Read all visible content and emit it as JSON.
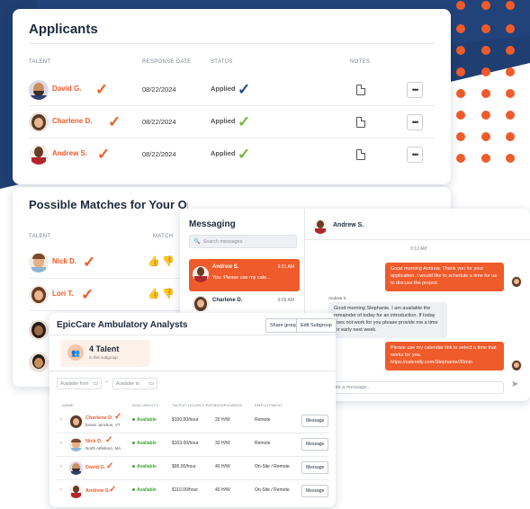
{
  "colors": {
    "accent": "#ef5b2b",
    "navy": "#1f3f72",
    "applied_blue": "#1f4e8c",
    "applied_green": "#6cbb3c",
    "available": "#3fa535"
  },
  "applicants": {
    "title": "Applicants",
    "headers": {
      "talent": "TALENT",
      "response_date": "RESPONSE DATE",
      "status": "STATUS",
      "notes": "NOTES"
    },
    "rows": [
      {
        "name": "David G.",
        "date": "08/22/2024",
        "status": "Applied",
        "status_color": "blue"
      },
      {
        "name": "Charlene D.",
        "date": "08/22/2024",
        "status": "Applied",
        "status_color": "green"
      },
      {
        "name": "Andrew S.",
        "date": "08/22/2024",
        "status": "Applied",
        "status_color": "green"
      }
    ],
    "more_label": "•••"
  },
  "matches": {
    "title": "Possible Matches for Your Opportunity",
    "headers": {
      "talent": "TALENT",
      "match": "MATCH"
    },
    "rows": [
      {
        "name": "Nick D."
      },
      {
        "name": "Lori T."
      }
    ]
  },
  "messaging": {
    "title": "Messaging",
    "search_placeholder": "Search messages",
    "active_contact": "Andrew S.",
    "conversations": [
      {
        "name": "Andrew S.",
        "time": "9:21 AM",
        "preview": "You: Please use my cale..."
      },
      {
        "name": "Charlene D.",
        "time": "9:09 AM",
        "preview": ""
      }
    ],
    "timestamp": "9:12 AM",
    "messages": [
      {
        "from": "me",
        "text": "Good morning Andrew. Thank you for your application. I would like to schedule a time for us to discuss the project."
      },
      {
        "from": "them",
        "sender": "Andrew S.",
        "text": "Good morning Stephanie. I am available the remainder of today for an introduction. If today does not work for you please provide me a time for early next week."
      },
      {
        "from": "me",
        "text": "Please use my calendar link to select a time that works for you. https://calendly.com/Stephanie/30min"
      }
    ],
    "input_placeholder": "Write a message..."
  },
  "epiccare": {
    "title": "EpicCare Ambulatory Analysts",
    "share_label": "Share group",
    "edit_label": "Edit Subgroup",
    "talent_count": "4 Talent",
    "talent_sub": "in this subgroup",
    "available_from": "Available from",
    "available_to": "Available to",
    "headers": {
      "name": "NAME",
      "availability": "AVAILABILITY",
      "rate": "TALENT HOURLY RATE",
      "hours": "HOURS/WEEK",
      "employment": "EMPLOYMENT"
    },
    "rows": [
      {
        "name": "Charlene D.",
        "location": "Essex Junction, VT",
        "availability": "Available",
        "rate": "$100.00/hour",
        "hours": "20 H/W",
        "employment": "Remote"
      },
      {
        "name": "Nick D.",
        "location": "North Attleboro, MA",
        "availability": "Available",
        "rate": "$103.00/hour",
        "hours": "32 H/W",
        "employment": "Remote"
      },
      {
        "name": "David G.",
        "location": "",
        "availability": "Available",
        "rate": "$95.00/hour",
        "hours": "40 H/W",
        "employment": "On-Site / Remote"
      },
      {
        "name": "Andrew S.",
        "location": "",
        "availability": "Available",
        "rate": "$110.00/hour",
        "hours": "40 H/W",
        "employment": "On-Site / Remote"
      }
    ],
    "message_label": "Message"
  }
}
